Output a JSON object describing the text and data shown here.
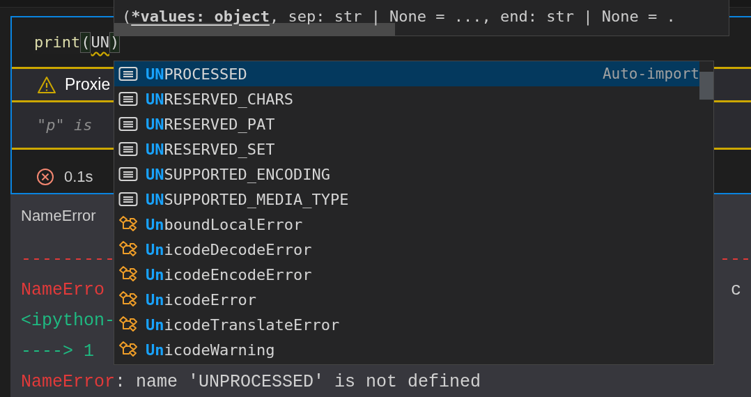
{
  "cell": {
    "code": {
      "function": "print",
      "open": "(",
      "typed": "UN",
      "close": ")"
    },
    "diagnostic": {
      "title": "Proxie",
      "message": "\"p\" is"
    },
    "status": {
      "failed": true,
      "time": "0.1s"
    }
  },
  "output": {
    "heading": "NameError",
    "lines": [
      {
        "kind": "rule",
        "left": "---------",
        "right": "---"
      },
      {
        "kind": "error",
        "name": "NameErro",
        "right": "c"
      },
      {
        "kind": "location",
        "text": "<ipython-"
      },
      {
        "kind": "arrow",
        "arrow": "---->",
        "number": "1"
      },
      {
        "kind": "error",
        "name": "NameError",
        "text": ": name 'UNPROCESSED' is not defined"
      }
    ]
  },
  "signature_hint": {
    "open": "(",
    "active_param": "*values: object",
    "rest": ", sep: str | None = ..., end: str | None = ."
  },
  "suggestions": [
    {
      "kind": "constant",
      "match": "UN",
      "rest": "PROCESSED",
      "selected": true,
      "detail": "Auto-import"
    },
    {
      "kind": "constant",
      "match": "UN",
      "rest": "RESERVED_CHARS",
      "selected": false
    },
    {
      "kind": "constant",
      "match": "UN",
      "rest": "RESERVED_PAT",
      "selected": false
    },
    {
      "kind": "constant",
      "match": "UN",
      "rest": "RESERVED_SET",
      "selected": false
    },
    {
      "kind": "constant",
      "match": "UN",
      "rest": "SUPPORTED_ENCODING",
      "selected": false
    },
    {
      "kind": "constant",
      "match": "UN",
      "rest": "SUPPORTED_MEDIA_TYPE",
      "selected": false
    },
    {
      "kind": "class",
      "match": "Un",
      "rest": "boundLocalError",
      "selected": false
    },
    {
      "kind": "class",
      "match": "Un",
      "rest": "icodeDecodeError",
      "selected": false
    },
    {
      "kind": "class",
      "match": "Un",
      "rest": "icodeEncodeError",
      "selected": false
    },
    {
      "kind": "class",
      "match": "Un",
      "rest": "icodeError",
      "selected": false
    },
    {
      "kind": "class",
      "match": "Un",
      "rest": "icodeTranslateError",
      "selected": false
    },
    {
      "kind": "class",
      "match": "Un",
      "rest": "icodeWarning",
      "selected": false
    }
  ]
}
